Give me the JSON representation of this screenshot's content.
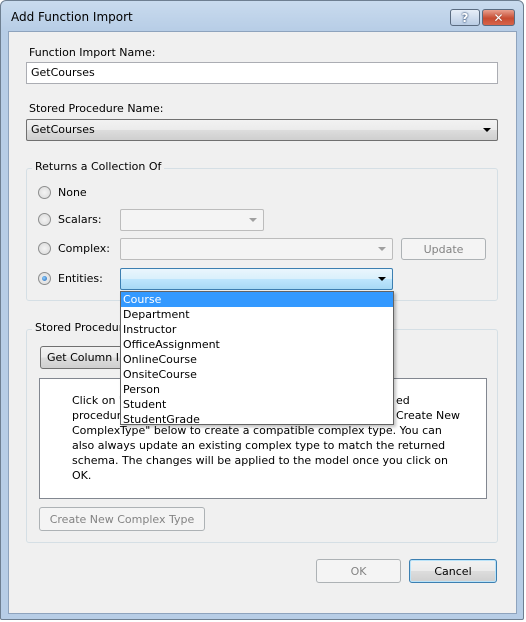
{
  "window": {
    "title": "Add Function Import"
  },
  "function_import": {
    "label": "Function Import Name:",
    "value": "GetCourses"
  },
  "stored_procedure": {
    "label": "Stored Procedure Name:",
    "value": "GetCourses"
  },
  "returns": {
    "title": "Returns a Collection Of",
    "options": [
      {
        "label": "None",
        "checked": false
      },
      {
        "label": "Scalars:",
        "checked": false
      },
      {
        "label": "Complex:",
        "checked": false
      },
      {
        "label": "Entities:",
        "checked": true
      }
    ],
    "update_label": "Update",
    "entities_dropdown": {
      "selected": "",
      "items": [
        "Course",
        "Department",
        "Instructor",
        "OfficeAssignment",
        "OnlineCourse",
        "OnsiteCourse",
        "Person",
        "Student",
        "StudentGrade"
      ],
      "highlighted": "Course"
    }
  },
  "sp_columns": {
    "title_visible": "Stored Procedur",
    "get_column_label_visible": "Get Column In",
    "info_lines": [
      "Click on \"",
      "procedur",
      "Complex ",
      "also always update an existing complex type to match the returned",
      "schema. The changes will be applied to the model once you click on",
      "OK."
    ],
    "info_line_right_1": "ed",
    "info_line_right_2": "Create New",
    "info_line_3_rest": "Type\" below to create a compatible complex type. You can",
    "create_complex_label": "Create New Complex Type"
  },
  "footer": {
    "ok_label": "OK",
    "cancel_label": "Cancel"
  }
}
